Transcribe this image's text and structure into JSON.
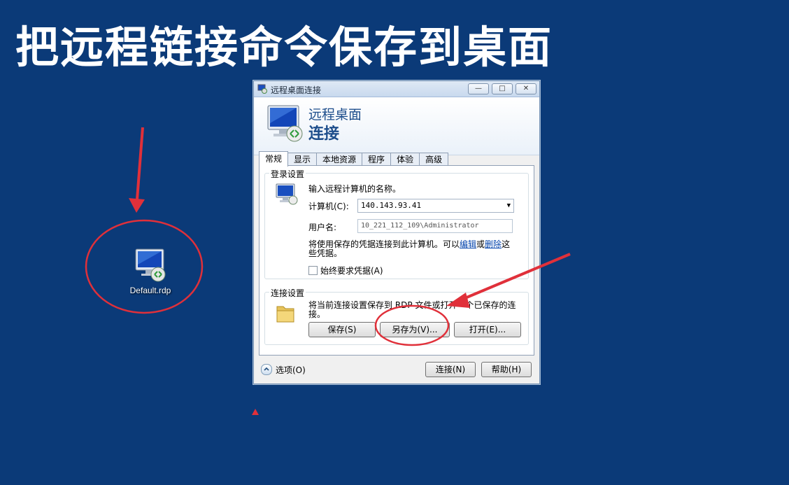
{
  "slide": {
    "title": "把远程链接命令保存到桌面"
  },
  "desktop": {
    "file_name": "Default.rdp"
  },
  "dialog": {
    "window_title": "远程桌面连接",
    "banner_line1": "远程桌面",
    "banner_line2": "连接",
    "window_buttons": {
      "minimize": "—",
      "maximize": "□",
      "close": "✕"
    },
    "tabs": [
      "常规",
      "显示",
      "本地资源",
      "程序",
      "体验",
      "高级"
    ],
    "login": {
      "group_label": "登录设置",
      "prompt": "输入远程计算机的名称。",
      "computer_label": "计算机(C):",
      "computer_value": "140.143.93.41",
      "username_label": "用户名:",
      "username_value": "10_221_112_109\\Administrator",
      "cred_text_prefix": "将使用保存的凭据连接到此计算机。可以",
      "edit_link": "编辑",
      "or_text": "或",
      "delete_link": "删除",
      "cred_text_suffix": "这些凭据。",
      "always_ask_label": "始终要求凭据(A)"
    },
    "connection": {
      "group_label": "连接设置",
      "description": "将当前连接设置保存到 RDP 文件或打开一个已保存的连接。",
      "save_button": "保存(S)",
      "save_as_button": "另存为(V)...",
      "open_button": "打开(E)..."
    },
    "footer": {
      "options_label": "选项(O)",
      "connect_button": "连接(N)",
      "help_button": "帮助(H)"
    }
  },
  "colors": {
    "background": "#0b3a78",
    "annotation": "#e0303a"
  }
}
